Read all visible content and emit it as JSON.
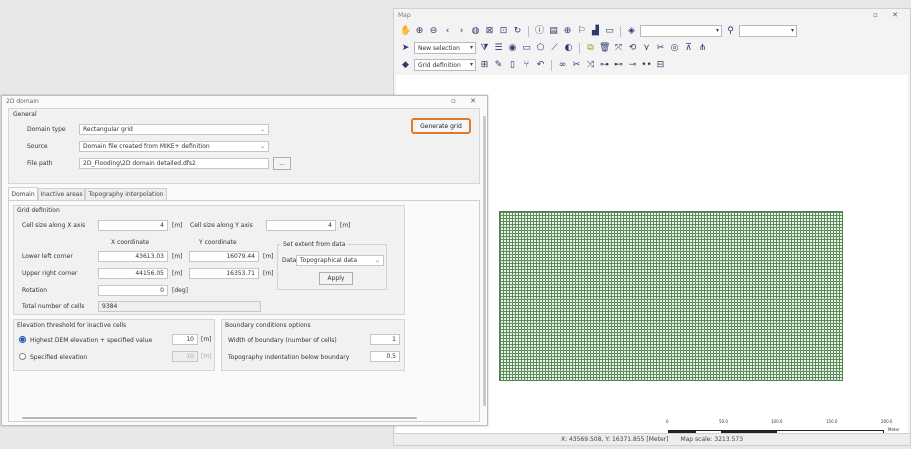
{
  "map": {
    "title": "Map",
    "window_buttons": "▫ ✕",
    "toolbar1_combo1": "",
    "toolbar1_combo2": "",
    "toolbar2_selection": "New selection",
    "toolbar3_grid": "Grid definition",
    "status": {
      "coords": "X: 43569.508, Y: 16371.855 [Meter]",
      "scale": "Map scale: 3213.573"
    },
    "scale_labels": [
      "0",
      "50.0",
      "100.0",
      "150.0",
      "200.0"
    ],
    "scale_unit": "Meter"
  },
  "dialog": {
    "title": "2D domain",
    "window_buttons": "▫ ✕",
    "general": {
      "label": "General",
      "domain_type_label": "Domain type",
      "domain_type_value": "Rectangular grid",
      "source_label": "Source",
      "source_value": "Domain file created from MIKE+ definition",
      "file_path_label": "File path",
      "file_path_value": "2D_Flooding\\2D domain detailed.dfs2",
      "browse_label": "..."
    },
    "tabs": [
      "Domain",
      "Inactive areas",
      "Topography interpolation"
    ],
    "grid_def": {
      "label": "Grid definition",
      "cell_x_label": "Cell size along X axis",
      "cell_x_value": "4",
      "cell_y_label": "Cell size along Y axis",
      "cell_y_value": "4",
      "unit_m": "[m]",
      "unit_deg": "[deg]",
      "x_coord_header": "X coordinate",
      "y_coord_header": "Y coordinate",
      "lower_left_label": "Lower left corner",
      "lower_left_x": "43613.03",
      "lower_left_y": "16079.44",
      "upper_right_label": "Upper right corner",
      "upper_right_x": "44156.05",
      "upper_right_y": "16353.71",
      "rotation_label": "Rotation",
      "rotation_value": "0",
      "total_cells_label": "Total number of cells",
      "total_cells_value": "9384",
      "extent_label": "Set extent from data",
      "data_label": "Data",
      "data_value": "Topographical data",
      "apply_label": "Apply",
      "generate_label": "Generate grid"
    },
    "elevation": {
      "label": "Elevation threshold for inactive cells",
      "opt1_label": "Highest DEM elevation + specified value",
      "opt1_value": "10",
      "opt2_label": "Specified elevation",
      "opt2_value": "10"
    },
    "boundary": {
      "label": "Boundary conditions options",
      "width_label": "Width of boundary (number of cells)",
      "width_value": "1",
      "indent_label": "Topography indentation below boundary",
      "indent_value": "0.5"
    }
  }
}
